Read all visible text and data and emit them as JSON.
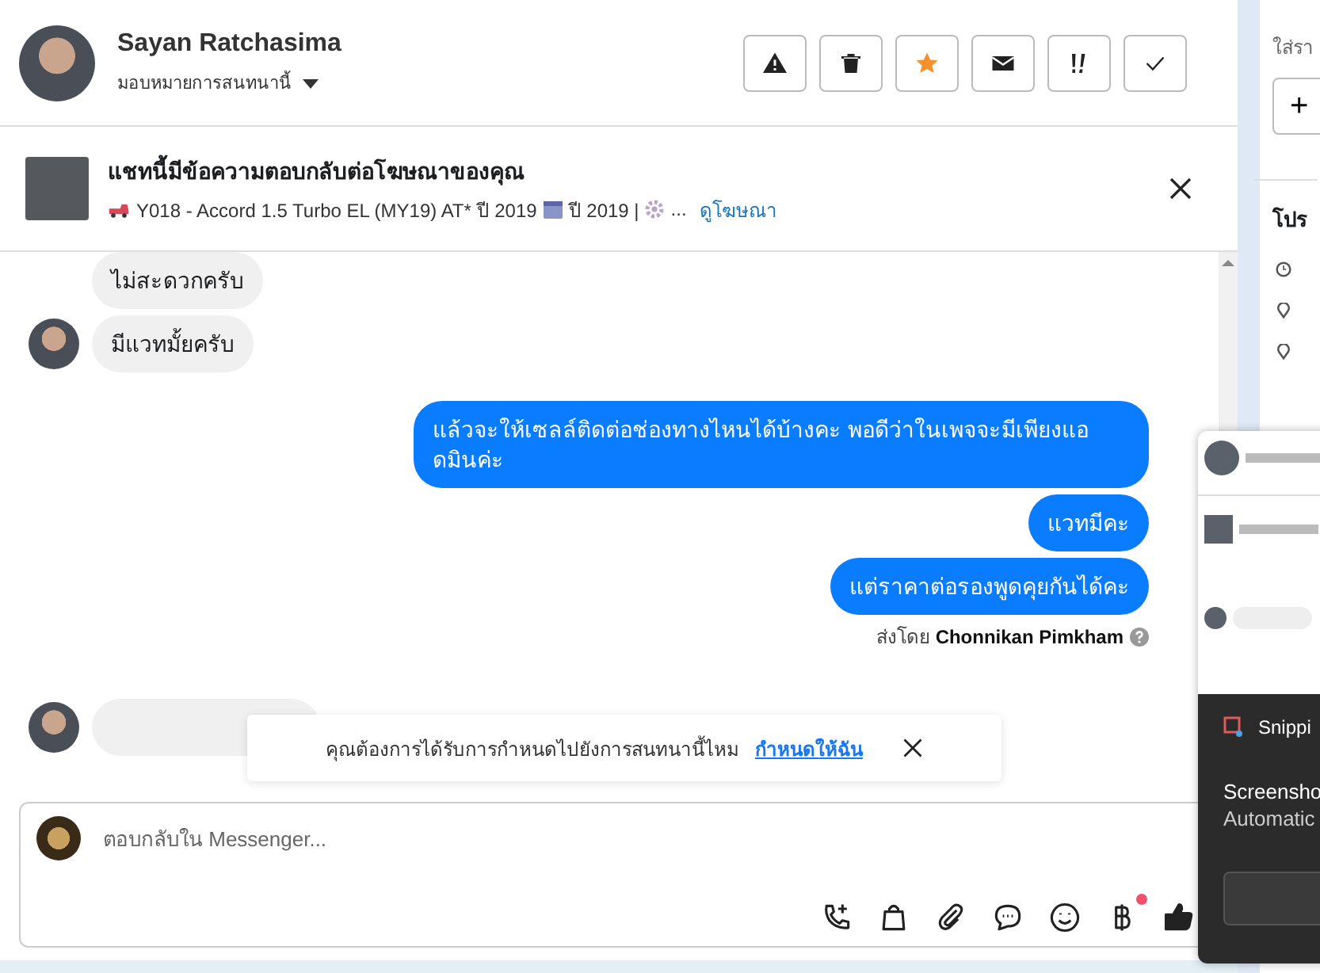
{
  "header": {
    "name": "Sayan Ratchasima",
    "assign_label": "มอบหมายการสนทนานี้",
    "actions": [
      {
        "kind": "alert",
        "on": false
      },
      {
        "kind": "trash",
        "on": false
      },
      {
        "kind": "star",
        "on": true
      },
      {
        "kind": "mail",
        "on": false
      },
      {
        "kind": "urgent",
        "on": false
      },
      {
        "kind": "done",
        "on": false
      }
    ]
  },
  "ad_banner": {
    "title": "แชทนี้มีข้อความตอบกลับต่อโฆษณาของคุณ",
    "model": "Y018 - Accord 1.5 Turbo EL (MY19) AT* ปี 2019",
    "year": "ปี 2019 |",
    "more": "...",
    "link": "ดูโฆษณา"
  },
  "messages": [
    {
      "kind": "incoming",
      "avatar": false,
      "text": "ไม่สะดวกครับ"
    },
    {
      "kind": "incoming",
      "avatar": true,
      "text": "มีแวทมั้ยครับ"
    },
    {
      "kind": "outgoing",
      "text": "แล้วจะให้เซลล์ติดต่อช่องทางไหนได้บ้างคะ พอดีว่าในเพจจะมีเพียงแอดมินค่ะ"
    },
    {
      "kind": "outgoing",
      "text": "แวทมีคะ"
    },
    {
      "kind": "outgoing",
      "text": "แต่ราคาต่อรองพูดคุยกันได้คะ"
    }
  ],
  "sent_by": {
    "label": "ส่งโดย",
    "name": "Chonnikan Pimkham"
  },
  "assign_prompt": {
    "text": "คุณต้องการได้รับการกำหนดไปยังการสนทนานี้ไหม",
    "link": "กำหนดให้ฉัน"
  },
  "composer": {
    "placeholder": "ตอบกลับใน Messenger...",
    "tools": [
      {
        "kind": "call",
        "badge": false
      },
      {
        "kind": "bag",
        "badge": false
      },
      {
        "kind": "clip",
        "badge": false
      },
      {
        "kind": "chat",
        "badge": false
      },
      {
        "kind": "smile",
        "badge": false
      },
      {
        "kind": "baht",
        "badge": true
      },
      {
        "kind": "like",
        "badge": false
      }
    ]
  },
  "right_panel": {
    "hint": "ใส่รา",
    "add": "+",
    "section_title": "โปร"
  },
  "snipping_notification": {
    "app": "Snippi",
    "title": "Screensho",
    "body": "Automatic"
  }
}
